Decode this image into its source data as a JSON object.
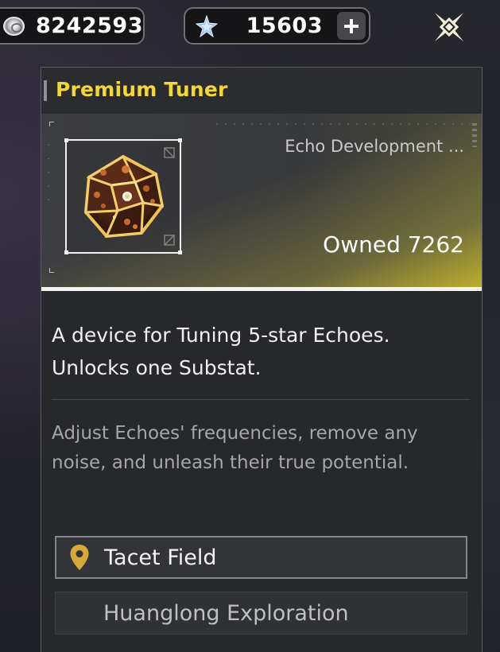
{
  "currencies": {
    "shell_credits": {
      "icon": "coin-icon",
      "value": "8242593"
    },
    "astrite": {
      "icon": "star-crystal-icon",
      "value": "15603",
      "add_label": "+"
    }
  },
  "close": {
    "icon": "close-x-icon"
  },
  "item": {
    "name": "Premium Tuner",
    "category": "Echo Development ...",
    "owned": "Owned 7262",
    "image": "premium-tuner-dice-icon",
    "description": "A device for Tuning 5-star Echoes. Unlocks one Substat.",
    "lore": "Adjust Echoes' frequencies, remove any noise, and unleash their true potential.",
    "rarity_color": "#f2d63a"
  },
  "sources": [
    {
      "label": "Tacet Field",
      "icon": "location-pin-icon"
    },
    {
      "label": "Huanglong Exploration"
    }
  ],
  "colors": {
    "title": "#f2d63a",
    "pin": "#d7a93b",
    "accent_gradient": "#e2ce28"
  }
}
